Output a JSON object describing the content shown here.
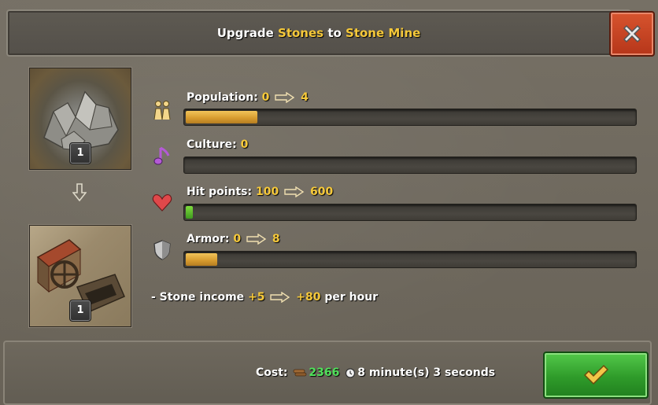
{
  "header": {
    "title_prefix": "Upgrade",
    "from_building": "Stones",
    "title_middle": "to",
    "to_building": "Stone Mine"
  },
  "buildings": {
    "current_level": "1",
    "next_level": "1"
  },
  "stats": [
    {
      "label": "Population:",
      "from": "0",
      "to": "4",
      "icon": "population-icon",
      "fill_fraction": 0.16
    },
    {
      "label": "Culture:",
      "value": "0",
      "icon": "music-note-icon",
      "fill_fraction": 0.0
    },
    {
      "label": "Hit points:",
      "from": "100",
      "to": "600",
      "icon": "heart-icon",
      "fill_fraction": 0.015
    },
    {
      "label": "Armor:",
      "from": "0",
      "to": "8",
      "icon": "shield-icon",
      "fill_fraction": 0.07
    }
  ],
  "income": {
    "prefix": "- Stone income",
    "from": "+5",
    "to": "+80",
    "suffix": "per hour"
  },
  "footer": {
    "cost_label": "Cost:",
    "wood_amount": "2366",
    "time_text": "8 minute(s) 3 seconds"
  },
  "colors": {
    "highlight": "#f6c93a",
    "amount_green": "#50e05a",
    "bar_fill": "#e3ad40",
    "close_red": "#c8421f",
    "confirm_green": "#36a630"
  }
}
